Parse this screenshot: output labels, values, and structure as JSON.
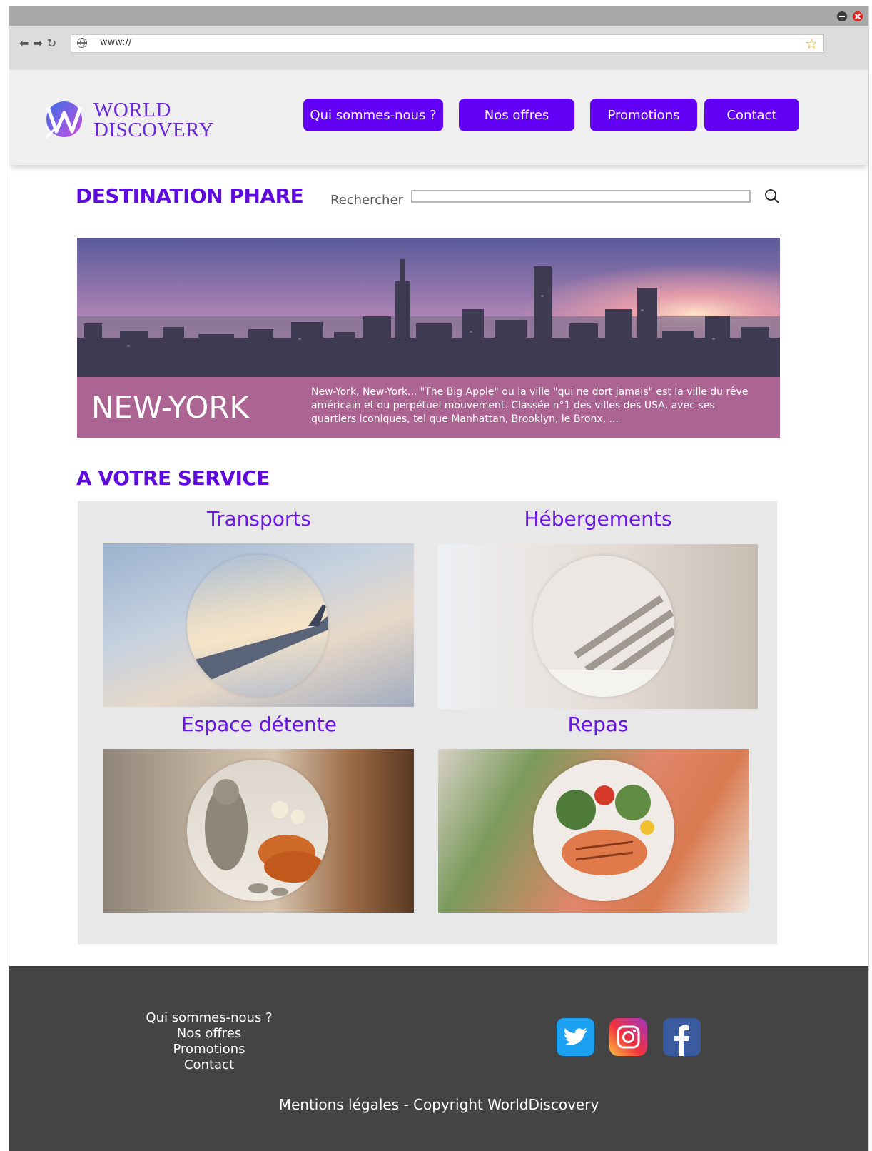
{
  "browser": {
    "url": "www://"
  },
  "header": {
    "logo_line1": "WORLD",
    "logo_line2": "DISCOVERY",
    "nav": [
      {
        "label": "Qui sommes-nous ?"
      },
      {
        "label": "Nos offres"
      },
      {
        "label": "Promotions"
      },
      {
        "label": "Contact"
      }
    ]
  },
  "featured": {
    "title": "DESTINATION PHARE",
    "search_label": "Rechercher",
    "search_value": "",
    "city": "NEW-YORK",
    "description": "New-York, New-York... \"The Big Apple\" ou la ville \"qui ne dort jamais\" est la ville du rêve américain et du perpétuel mouvement. Classée n°1 des villes des USA, avec ses quartiers iconiques, tel que Manhattan, Brooklyn, le Bronx, ..."
  },
  "services": {
    "title": "A VOTRE SERVICE",
    "items": [
      {
        "label": "Transports"
      },
      {
        "label": "Hébergements"
      },
      {
        "label": "Espace détente"
      },
      {
        "label": "Repas"
      }
    ]
  },
  "footer": {
    "links": [
      {
        "label": "Qui sommes-nous ?"
      },
      {
        "label": "Nos offres"
      },
      {
        "label": "Promotions"
      },
      {
        "label": "Contact"
      }
    ],
    "social": [
      "twitter-icon",
      "instagram-icon",
      "facebook-icon"
    ],
    "copyright": "Mentions légales - Copyright WorldDiscovery"
  },
  "colors": {
    "accent": "#6100f5",
    "footer_bg": "#444444",
    "caption_bg": "#c46ea0"
  }
}
